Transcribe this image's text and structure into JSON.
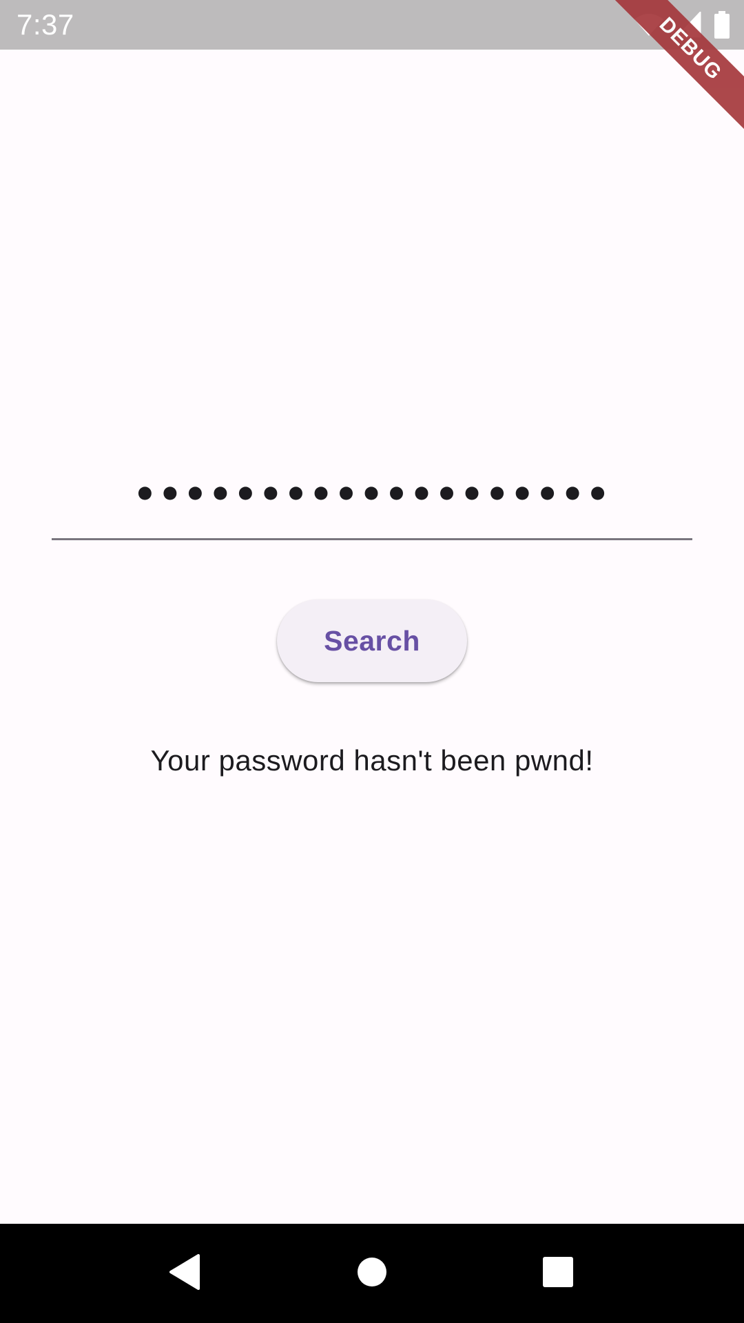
{
  "status_bar": {
    "time": "7:37",
    "icons": [
      "wifi-icon",
      "cell-signal-icon",
      "battery-icon"
    ]
  },
  "debug_banner": {
    "label": "DEBUG",
    "color": "#a5383c"
  },
  "password_field": {
    "value": "•••••••••••••••••••",
    "underline_color": "#79747e"
  },
  "search_button": {
    "label": "Search",
    "text_color": "#6750a4",
    "background": "#f4eff6"
  },
  "result": {
    "message": "Your password hasn't been pwnd!"
  },
  "nav_bar": {
    "buttons": [
      "back-icon",
      "home-icon",
      "recents-icon"
    ]
  },
  "colors": {
    "background": "#fffbfe",
    "status_bar": "#bdbbbc",
    "text": "#1c1b1f"
  }
}
